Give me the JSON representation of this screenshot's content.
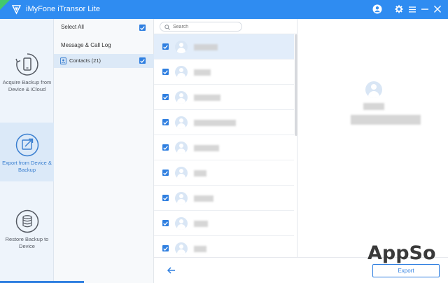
{
  "app": {
    "title": "iMyFone iTransor Lite",
    "accent": "#2f8cf1",
    "icons": [
      "account-icon",
      "gear-icon",
      "menu-icon",
      "minimize-icon",
      "close-icon"
    ]
  },
  "nav": {
    "items": [
      {
        "label": "Acquire Backup from Device & iCloud",
        "icon": "phone-sync-icon"
      },
      {
        "label": "Export from Device & Backup",
        "icon": "export-icon"
      },
      {
        "label": "Restore Backup to Device",
        "icon": "database-restore-icon"
      }
    ]
  },
  "categories": {
    "select_all": "Select All",
    "group": "Message & Call Log",
    "contacts": "Contacts (21)"
  },
  "search": {
    "placeholder": "Search"
  },
  "footer": {
    "export_label": "Export",
    "watermark": "AppSo"
  }
}
